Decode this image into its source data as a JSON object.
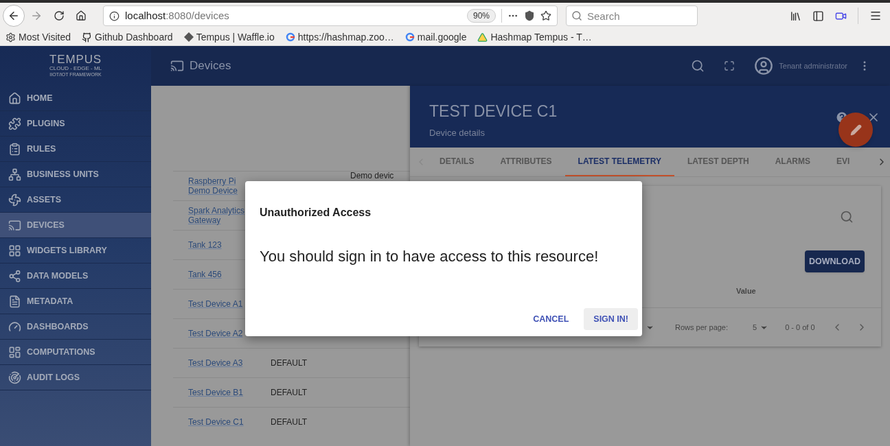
{
  "browser": {
    "url_host": "localhost",
    "url_path": ":8080/devices",
    "zoom": "90%",
    "search_placeholder": "Search",
    "bookmarks": [
      {
        "label": "Most Visited"
      },
      {
        "label": "Github Dashboard"
      },
      {
        "label": "Tempus | Waffle.io"
      },
      {
        "label": "https://hashmap.zoo…"
      },
      {
        "label": "mail.google"
      },
      {
        "label": "Hashmap Tempus - T…"
      }
    ]
  },
  "logo": {
    "name": "TEMPUS",
    "tagline": "CLOUD - EDGE - ML",
    "subtitle": "IIOT/IOT FRAMEWORK"
  },
  "header": {
    "title": "Devices",
    "user": "Tenant administrator"
  },
  "sidebar": {
    "items": [
      {
        "label": "HOME",
        "selected": false
      },
      {
        "label": "PLUGINS",
        "selected": false
      },
      {
        "label": "RULES",
        "selected": false
      },
      {
        "label": "BUSINESS UNITS",
        "selected": false
      },
      {
        "label": "ASSETS",
        "selected": false
      },
      {
        "label": "DEVICES",
        "selected": true
      },
      {
        "label": "WIDGETS LIBRARY",
        "selected": false
      },
      {
        "label": "DATA MODELS",
        "selected": false
      },
      {
        "label": "METADATA",
        "selected": false
      },
      {
        "label": "DASHBOARDS",
        "selected": false
      },
      {
        "label": "COMPUTATIONS",
        "selected": false
      },
      {
        "label": "AUDIT LOGS",
        "selected": false
      }
    ]
  },
  "devices": [
    {
      "name": "Raspberry Pi Demo Device",
      "description": "Demo devic"
    },
    {
      "name": "Spark Analytics Gateway"
    },
    {
      "name": "Tank 123"
    },
    {
      "name": "Tank 456"
    },
    {
      "name": "Test Device A1"
    },
    {
      "name": "Test Device A2"
    },
    {
      "name": "Test Device A3",
      "type": "DEFAULT"
    },
    {
      "name": "Test Device B1",
      "type": "DEFAULT"
    },
    {
      "name": "Test Device C1",
      "type": "DEFAULT"
    }
  ],
  "detail": {
    "title": "TEST DEVICE C1",
    "subtitle": "Device details",
    "tabs": [
      {
        "label": "DETAILS",
        "selected": false
      },
      {
        "label": "ATTRIBUTES",
        "selected": false
      },
      {
        "label": "LATEST TELEMETRY",
        "selected": true
      },
      {
        "label": "LATEST DEPTH",
        "selected": false
      },
      {
        "label": "ALARMS",
        "selected": false
      },
      {
        "label": "EVI",
        "selected": false
      }
    ],
    "download": "DOWNLOAD",
    "column": "Value",
    "rows_label": "Rows per page:",
    "rows_value": "5",
    "range": "0 - 0 of 0"
  },
  "dialog": {
    "title": "Unauthorized Access",
    "message": "You should sign in to have access to this resource!",
    "buttons": [
      {
        "label": "CANCEL",
        "kind": "flat"
      },
      {
        "label": "SIGN IN!",
        "kind": "raised"
      }
    ]
  }
}
